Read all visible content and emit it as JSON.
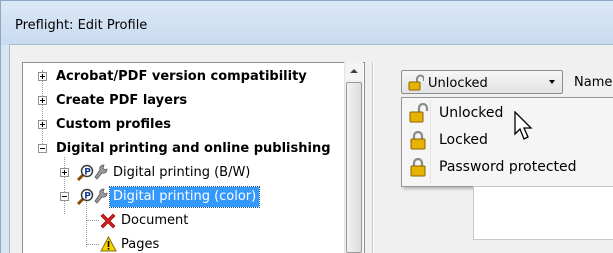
{
  "window": {
    "title": "Preflight: Edit Profile"
  },
  "tree": {
    "items": [
      {
        "label": "Acrobat/PDF version compatibility",
        "expander": "plus"
      },
      {
        "label": "Create PDF layers",
        "expander": "plus"
      },
      {
        "label": "Custom profiles",
        "expander": "plus"
      },
      {
        "label": "Digital printing and online publishing",
        "expander": "minus"
      },
      {
        "label": "Digital printing (B/W)",
        "expander": "plus"
      },
      {
        "label": "Digital printing (color)",
        "expander": "minus",
        "selected": true
      },
      {
        "label": "Document"
      },
      {
        "label": "Pages"
      }
    ]
  },
  "lock_dropdown": {
    "value": "Unlocked"
  },
  "name_label": "Name:",
  "lock_menu": {
    "items": [
      {
        "label": "Unlocked",
        "icon": "lock-open-icon"
      },
      {
        "label": "Locked",
        "icon": "lock-closed-icon"
      },
      {
        "label": "Password protected",
        "icon": "lock-closed-icon"
      }
    ]
  },
  "colors": {
    "selection": "#3399ff",
    "title_bar": "#d3e3f5",
    "lock_gold": "#e8b200",
    "error_red": "#d02020",
    "warning_yellow": "#f6d500"
  }
}
